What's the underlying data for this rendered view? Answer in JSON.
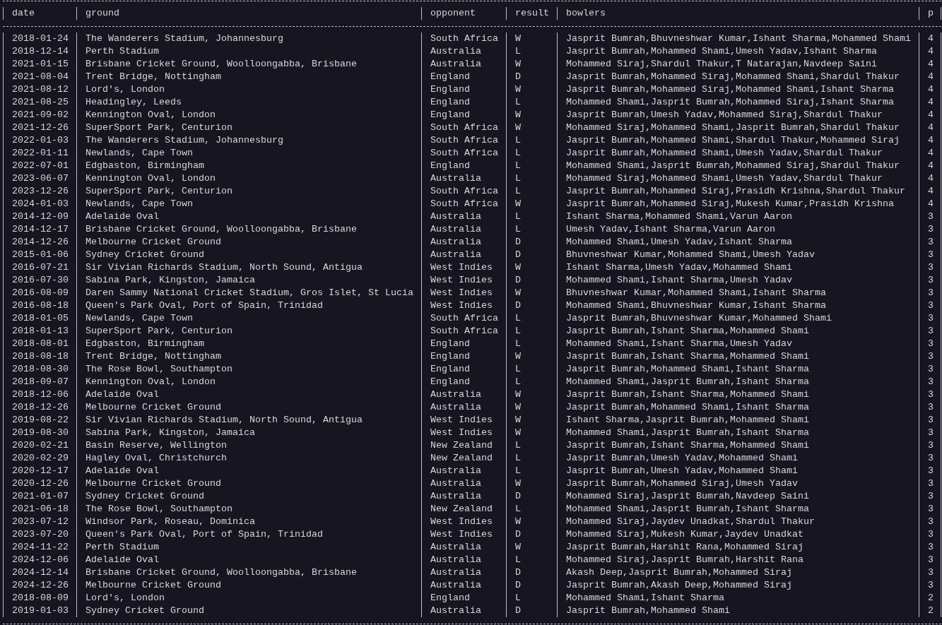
{
  "table": {
    "columns": [
      "date",
      "ground",
      "opponent",
      "result",
      "bowlers",
      "p"
    ],
    "rows": [
      [
        "2018-01-24",
        "The Wanderers Stadium, Johannesburg",
        "South Africa",
        "W",
        "Jasprit Bumrah,Bhuvneshwar Kumar,Ishant Sharma,Mohammed Shami",
        "4"
      ],
      [
        "2018-12-14",
        "Perth Stadium",
        "Australia",
        "L",
        "Jasprit Bumrah,Mohammed Shami,Umesh Yadav,Ishant Sharma",
        "4"
      ],
      [
        "2021-01-15",
        "Brisbane Cricket Ground, Woolloongabba, Brisbane",
        "Australia",
        "W",
        "Mohammed Siraj,Shardul Thakur,T Natarajan,Navdeep Saini",
        "4"
      ],
      [
        "2021-08-04",
        "Trent Bridge, Nottingham",
        "England",
        "D",
        "Jasprit Bumrah,Mohammed Siraj,Mohammed Shami,Shardul Thakur",
        "4"
      ],
      [
        "2021-08-12",
        "Lord's, London",
        "England",
        "W",
        "Jasprit Bumrah,Mohammed Siraj,Mohammed Shami,Ishant Sharma",
        "4"
      ],
      [
        "2021-08-25",
        "Headingley, Leeds",
        "England",
        "L",
        "Mohammed Shami,Jasprit Bumrah,Mohammed Siraj,Ishant Sharma",
        "4"
      ],
      [
        "2021-09-02",
        "Kennington Oval, London",
        "England",
        "W",
        "Jasprit Bumrah,Umesh Yadav,Mohammed Siraj,Shardul Thakur",
        "4"
      ],
      [
        "2021-12-26",
        "SuperSport Park, Centurion",
        "South Africa",
        "W",
        "Mohammed Siraj,Mohammed Shami,Jasprit Bumrah,Shardul Thakur",
        "4"
      ],
      [
        "2022-01-03",
        "The Wanderers Stadium, Johannesburg",
        "South Africa",
        "L",
        "Jasprit Bumrah,Mohammed Shami,Shardul Thakur,Mohammed Siraj",
        "4"
      ],
      [
        "2022-01-11",
        "Newlands, Cape Town",
        "South Africa",
        "L",
        "Jasprit Bumrah,Mohammed Shami,Umesh Yadav,Shardul Thakur",
        "4"
      ],
      [
        "2022-07-01",
        "Edgbaston, Birmingham",
        "England",
        "L",
        "Mohammed Shami,Jasprit Bumrah,Mohammed Siraj,Shardul Thakur",
        "4"
      ],
      [
        "2023-06-07",
        "Kennington Oval, London",
        "Australia",
        "L",
        "Mohammed Siraj,Mohammed Shami,Umesh Yadav,Shardul Thakur",
        "4"
      ],
      [
        "2023-12-26",
        "SuperSport Park, Centurion",
        "South Africa",
        "L",
        "Jasprit Bumrah,Mohammed Siraj,Prasidh Krishna,Shardul Thakur",
        "4"
      ],
      [
        "2024-01-03",
        "Newlands, Cape Town",
        "South Africa",
        "W",
        "Jasprit Bumrah,Mohammed Siraj,Mukesh Kumar,Prasidh Krishna",
        "4"
      ],
      [
        "2014-12-09",
        "Adelaide Oval",
        "Australia",
        "L",
        "Ishant Sharma,Mohammed Shami,Varun Aaron",
        "3"
      ],
      [
        "2014-12-17",
        "Brisbane Cricket Ground, Woolloongabba, Brisbane",
        "Australia",
        "L",
        "Umesh Yadav,Ishant Sharma,Varun Aaron",
        "3"
      ],
      [
        "2014-12-26",
        "Melbourne Cricket Ground",
        "Australia",
        "D",
        "Mohammed Shami,Umesh Yadav,Ishant Sharma",
        "3"
      ],
      [
        "2015-01-06",
        "Sydney Cricket Ground",
        "Australia",
        "D",
        "Bhuvneshwar Kumar,Mohammed Shami,Umesh Yadav",
        "3"
      ],
      [
        "2016-07-21",
        "Sir Vivian Richards Stadium, North Sound, Antigua",
        "West Indies",
        "W",
        "Ishant Sharma,Umesh Yadav,Mohammed Shami",
        "3"
      ],
      [
        "2016-07-30",
        "Sabina Park, Kingston, Jamaica",
        "West Indies",
        "D",
        "Mohammed Shami,Ishant Sharma,Umesh Yadav",
        "3"
      ],
      [
        "2016-08-09",
        "Daren Sammy National Cricket Stadium, Gros Islet, St Lucia",
        "West Indies",
        "W",
        "Bhuvneshwar Kumar,Mohammed Shami,Ishant Sharma",
        "3"
      ],
      [
        "2016-08-18",
        "Queen's Park Oval, Port of Spain, Trinidad",
        "West Indies",
        "D",
        "Mohammed Shami,Bhuvneshwar Kumar,Ishant Sharma",
        "3"
      ],
      [
        "2018-01-05",
        "Newlands, Cape Town",
        "South Africa",
        "L",
        "Jasprit Bumrah,Bhuvneshwar Kumar,Mohammed Shami",
        "3"
      ],
      [
        "2018-01-13",
        "SuperSport Park, Centurion",
        "South Africa",
        "L",
        "Jasprit Bumrah,Ishant Sharma,Mohammed Shami",
        "3"
      ],
      [
        "2018-08-01",
        "Edgbaston, Birmingham",
        "England",
        "L",
        "Mohammed Shami,Ishant Sharma,Umesh Yadav",
        "3"
      ],
      [
        "2018-08-18",
        "Trent Bridge, Nottingham",
        "England",
        "W",
        "Jasprit Bumrah,Ishant Sharma,Mohammed Shami",
        "3"
      ],
      [
        "2018-08-30",
        "The Rose Bowl, Southampton",
        "England",
        "L",
        "Jasprit Bumrah,Mohammed Shami,Ishant Sharma",
        "3"
      ],
      [
        "2018-09-07",
        "Kennington Oval, London",
        "England",
        "L",
        "Mohammed Shami,Jasprit Bumrah,Ishant Sharma",
        "3"
      ],
      [
        "2018-12-06",
        "Adelaide Oval",
        "Australia",
        "W",
        "Jasprit Bumrah,Ishant Sharma,Mohammed Shami",
        "3"
      ],
      [
        "2018-12-26",
        "Melbourne Cricket Ground",
        "Australia",
        "W",
        "Jasprit Bumrah,Mohammed Shami,Ishant Sharma",
        "3"
      ],
      [
        "2019-08-22",
        "Sir Vivian Richards Stadium, North Sound, Antigua",
        "West Indies",
        "W",
        "Ishant Sharma,Jasprit Bumrah,Mohammed Shami",
        "3"
      ],
      [
        "2019-08-30",
        "Sabina Park, Kingston, Jamaica",
        "West Indies",
        "W",
        "Mohammed Shami,Jasprit Bumrah,Ishant Sharma",
        "3"
      ],
      [
        "2020-02-21",
        "Basin Reserve, Wellington",
        "New Zealand",
        "L",
        "Jasprit Bumrah,Ishant Sharma,Mohammed Shami",
        "3"
      ],
      [
        "2020-02-29",
        "Hagley Oval, Christchurch",
        "New Zealand",
        "L",
        "Jasprit Bumrah,Umesh Yadav,Mohammed Shami",
        "3"
      ],
      [
        "2020-12-17",
        "Adelaide Oval",
        "Australia",
        "L",
        "Jasprit Bumrah,Umesh Yadav,Mohammed Shami",
        "3"
      ],
      [
        "2020-12-26",
        "Melbourne Cricket Ground",
        "Australia",
        "W",
        "Jasprit Bumrah,Mohammed Siraj,Umesh Yadav",
        "3"
      ],
      [
        "2021-01-07",
        "Sydney Cricket Ground",
        "Australia",
        "D",
        "Mohammed Siraj,Jasprit Bumrah,Navdeep Saini",
        "3"
      ],
      [
        "2021-06-18",
        "The Rose Bowl, Southampton",
        "New Zealand",
        "L",
        "Mohammed Shami,Jasprit Bumrah,Ishant Sharma",
        "3"
      ],
      [
        "2023-07-12",
        "Windsor Park, Roseau, Dominica",
        "West Indies",
        "W",
        "Mohammed Siraj,Jaydev Unadkat,Shardul Thakur",
        "3"
      ],
      [
        "2023-07-20",
        "Queen's Park Oval, Port of Spain, Trinidad",
        "West Indies",
        "D",
        "Mohammed Siraj,Mukesh Kumar,Jaydev Unadkat",
        "3"
      ],
      [
        "2024-11-22",
        "Perth Stadium",
        "Australia",
        "W",
        "Jasprit Bumrah,Harshit Rana,Mohammed Siraj",
        "3"
      ],
      [
        "2024-12-06",
        "Adelaide Oval",
        "Australia",
        "L",
        "Mohammed Siraj,Jasprit Bumrah,Harshit Rana",
        "3"
      ],
      [
        "2024-12-14",
        "Brisbane Cricket Ground, Woolloongabba, Brisbane",
        "Australia",
        "D",
        "Akash Deep,Jasprit Bumrah,Mohammed Siraj",
        "3"
      ],
      [
        "2024-12-26",
        "Melbourne Cricket Ground",
        "Australia",
        "D",
        "Jasprit Bumrah,Akash Deep,Mohammed Siraj",
        "3"
      ],
      [
        "2018-08-09",
        "Lord's, London",
        "England",
        "L",
        "Mohammed Shami,Ishant Sharma",
        "2"
      ],
      [
        "2019-01-03",
        "Sydney Cricket Ground",
        "Australia",
        "D",
        "Jasprit Bumrah,Mohammed Shami",
        "2"
      ]
    ]
  }
}
